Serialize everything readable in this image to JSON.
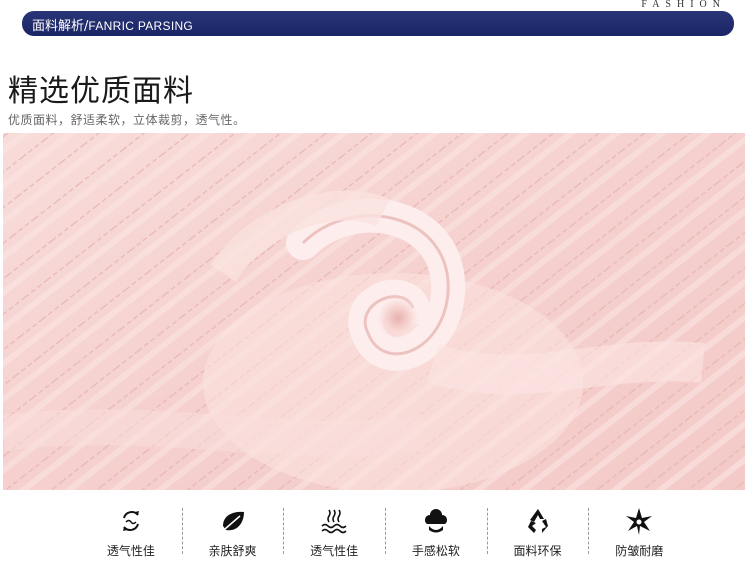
{
  "banner": {
    "title_cn": "面料解析/",
    "title_en": "FANRIC PARSING",
    "fashion": "FASHION"
  },
  "heading": {
    "title": "精选优质面料",
    "subtitle": "优质面料，舒适柔软，立体裁剪，透气性。"
  },
  "photo": {
    "colors": {
      "base": "#f6d4d2",
      "light": "#fbe4e1",
      "shadow": "#e9b9b6"
    }
  },
  "features": [
    {
      "label": "透气性佳",
      "icon": "airflow-icon"
    },
    {
      "label": "亲肤舒爽",
      "icon": "leaf-icon"
    },
    {
      "label": "透气性佳",
      "icon": "steam-waves-icon"
    },
    {
      "label": "手感松软",
      "icon": "cloud-hand-icon"
    },
    {
      "label": "面料环保",
      "icon": "recycle-icon"
    },
    {
      "label": "防皱耐磨",
      "icon": "star-burst-icon"
    }
  ]
}
